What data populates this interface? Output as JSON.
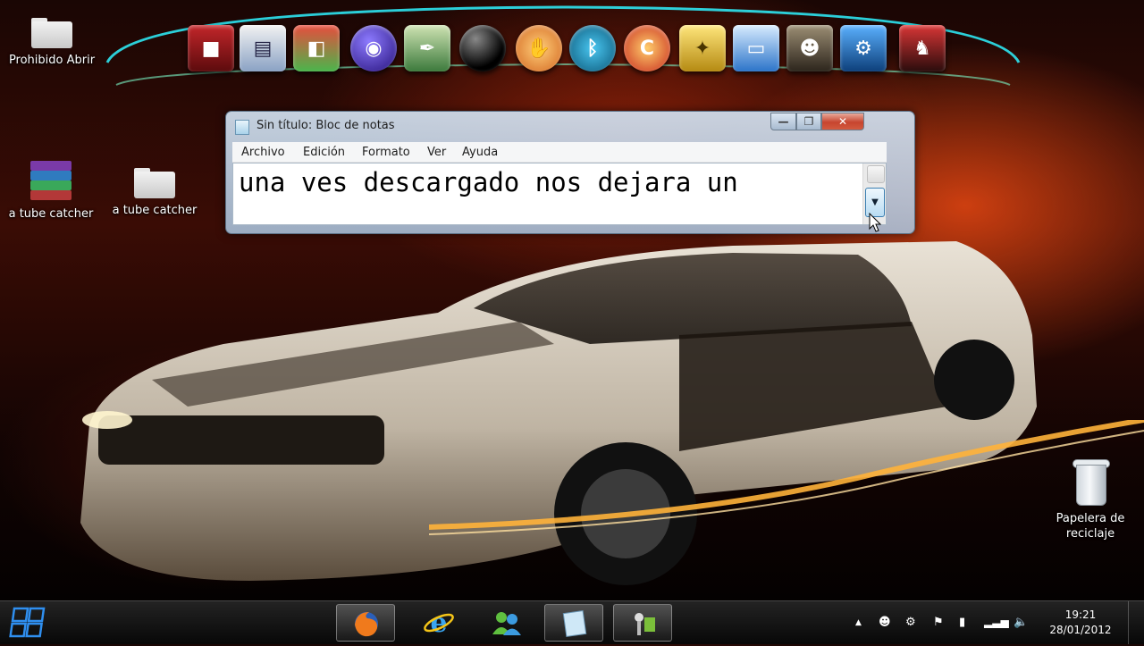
{
  "desktop": {
    "icons": [
      {
        "label": "Prohibido Abrir"
      },
      {
        "label": "a tube catcher"
      },
      {
        "label": "a tube catcher"
      },
      {
        "label": "Papelera de reciclaje"
      }
    ]
  },
  "dock": {
    "items": [
      "maroon-app-icon",
      "control-panel-icon",
      "office-icon",
      "blue-orb-icon",
      "feather-icon",
      "black-ball-icon",
      "hand-icon",
      "bluetooth-icon",
      "ccleaner-icon",
      "gadgets-icon",
      "display-icon",
      "gta-icon",
      "tools-icon",
      "character-icon"
    ]
  },
  "notepad": {
    "title": "Sin título: Bloc de notas",
    "menu": [
      "Archivo",
      "Edición",
      "Formato",
      "Ver",
      "Ayuda"
    ],
    "text": "una ves descargado nos dejara un",
    "close_glyph": "✕",
    "max_glyph": "❐",
    "min_glyph": "—",
    "scroll_down_glyph": "▼"
  },
  "taskbar": {
    "pinned": [
      "firefox-icon",
      "internet-explorer-icon",
      "messenger-icon",
      "notepad-icon",
      "media-icon"
    ],
    "tray": {
      "show_hidden": "▲",
      "time": "19:21",
      "date": "28/01/2012"
    }
  }
}
